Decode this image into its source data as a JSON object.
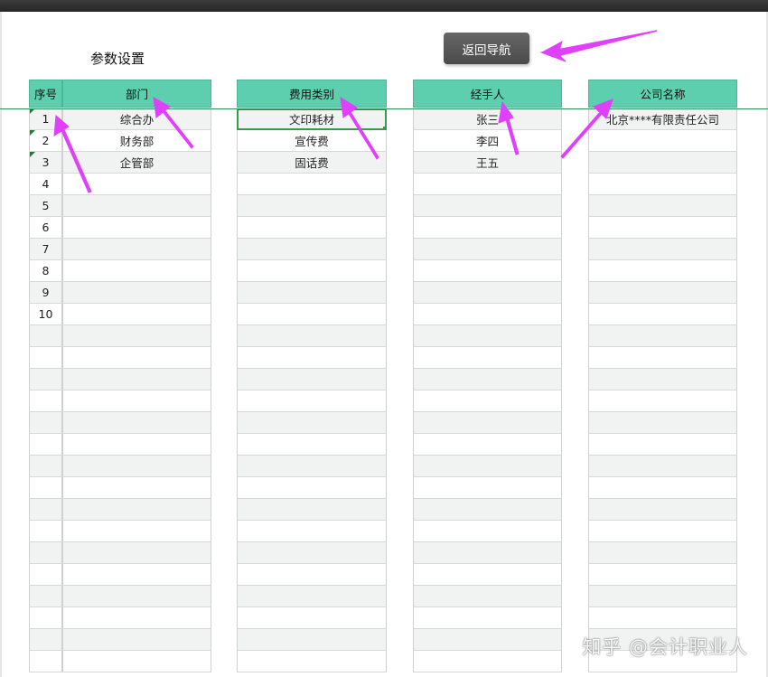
{
  "page": {
    "title": "参数设置",
    "nav_button": "返回导航"
  },
  "columns": {
    "seq": {
      "header": "序号",
      "values": [
        "1",
        "2",
        "3",
        "4",
        "5",
        "6",
        "7",
        "8",
        "9",
        "10"
      ]
    },
    "dept": {
      "header": "部门",
      "values": [
        "综合办",
        "财务部",
        "企管部"
      ]
    },
    "fee": {
      "header": "费用类别",
      "values": [
        "文印耗材",
        "宣传费",
        "固话费"
      ]
    },
    "handler": {
      "header": "经手人",
      "values": [
        "张三",
        "李四",
        "王五"
      ]
    },
    "company": {
      "header": "公司名称",
      "values": [
        "北京****有限责任公司"
      ]
    }
  },
  "watermark": "知乎 @会计职业人",
  "colors": {
    "header_bg": "#5ecfae",
    "arrow": "#e040fb",
    "selection": "#3a9a48"
  }
}
